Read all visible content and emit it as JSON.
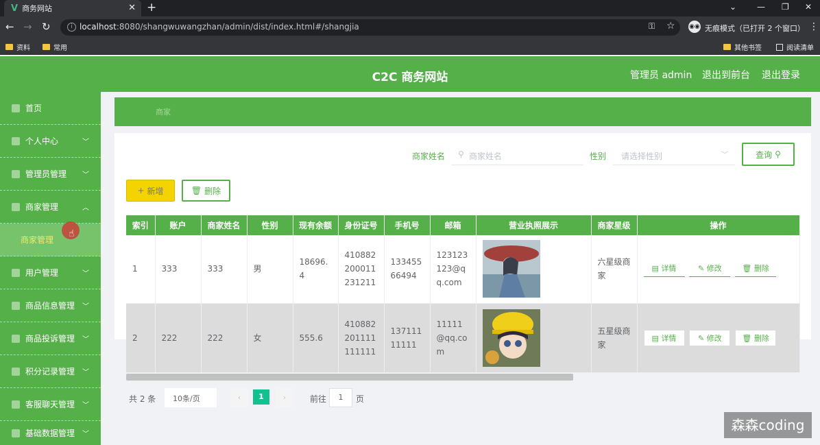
{
  "browser": {
    "tab_title": "商务网站",
    "tab_logo": "V",
    "url_host": "localhost",
    "url_rest": ":8080/shangwuwangzhan/admin/dist/index.html#/shangjia",
    "incognito_label": "无痕模式（已打开 2 个窗口）",
    "bookmarks": [
      "资料",
      "常用"
    ],
    "other_bookmarks": "其他书签",
    "reading_list": "阅读清单"
  },
  "header": {
    "title": "C2C 商务网站",
    "user": "管理员 admin",
    "to_front": "退出到前台",
    "logout": "退出登录"
  },
  "sidebar": {
    "items": [
      {
        "label": "首页",
        "icon": "home-icon",
        "chevron": ""
      },
      {
        "label": "个人中心",
        "icon": "user-icon",
        "chevron": "﹀"
      },
      {
        "label": "管理员管理",
        "icon": "list-icon",
        "chevron": "﹀"
      },
      {
        "label": "商家管理",
        "icon": "store-icon",
        "chevron": "︿"
      },
      {
        "label": "商家管理",
        "icon": "",
        "chevron": ""
      },
      {
        "label": "用户管理",
        "icon": "users-icon",
        "chevron": "﹀"
      },
      {
        "label": "商品信息管理",
        "icon": "goods-icon",
        "chevron": "﹀"
      },
      {
        "label": "商品投诉管理",
        "icon": "complaint-icon",
        "chevron": "﹀"
      },
      {
        "label": "积分记录管理",
        "icon": "points-icon",
        "chevron": "﹀"
      },
      {
        "label": "客服聊天管理",
        "icon": "chat-icon",
        "chevron": "﹀"
      },
      {
        "label": "基础数据管理",
        "icon": "data-icon",
        "chevron": "﹀"
      }
    ]
  },
  "breadcrumb": "商家",
  "search": {
    "name_label": "商家姓名",
    "name_placeholder": "商家姓名",
    "gender_label": "性别",
    "gender_placeholder": "请选择性别",
    "query_label": "查询"
  },
  "actions": {
    "add": "新增",
    "delete": "删除"
  },
  "table": {
    "headers": [
      "索引",
      "账户",
      "商家姓名",
      "性别",
      "现有余额",
      "身份证号",
      "手机号",
      "邮箱",
      "营业执照展示",
      "商家星级",
      "操作"
    ],
    "rows": [
      {
        "index": "1",
        "account": "333",
        "name": "333",
        "gender": "男",
        "balance": "18696.4",
        "id_no": "410882200011231211",
        "phone": "13345566494",
        "email": "123123123@qq.com",
        "star": "六星级商家"
      },
      {
        "index": "2",
        "account": "222",
        "name": "222",
        "gender": "女",
        "balance": "555.6",
        "id_no": "410882201111111111",
        "phone": "13711111111",
        "email": "11111@qq.com",
        "star": "五星级商家"
      }
    ],
    "op_detail": "详情",
    "op_edit": "修改",
    "op_delete": "删除"
  },
  "pager": {
    "total": "共 2 条",
    "page_size": "10条/页",
    "current": "1",
    "goto_label": "前往",
    "goto_value": "1",
    "page_suffix": "页"
  },
  "watermark": "森森coding"
}
